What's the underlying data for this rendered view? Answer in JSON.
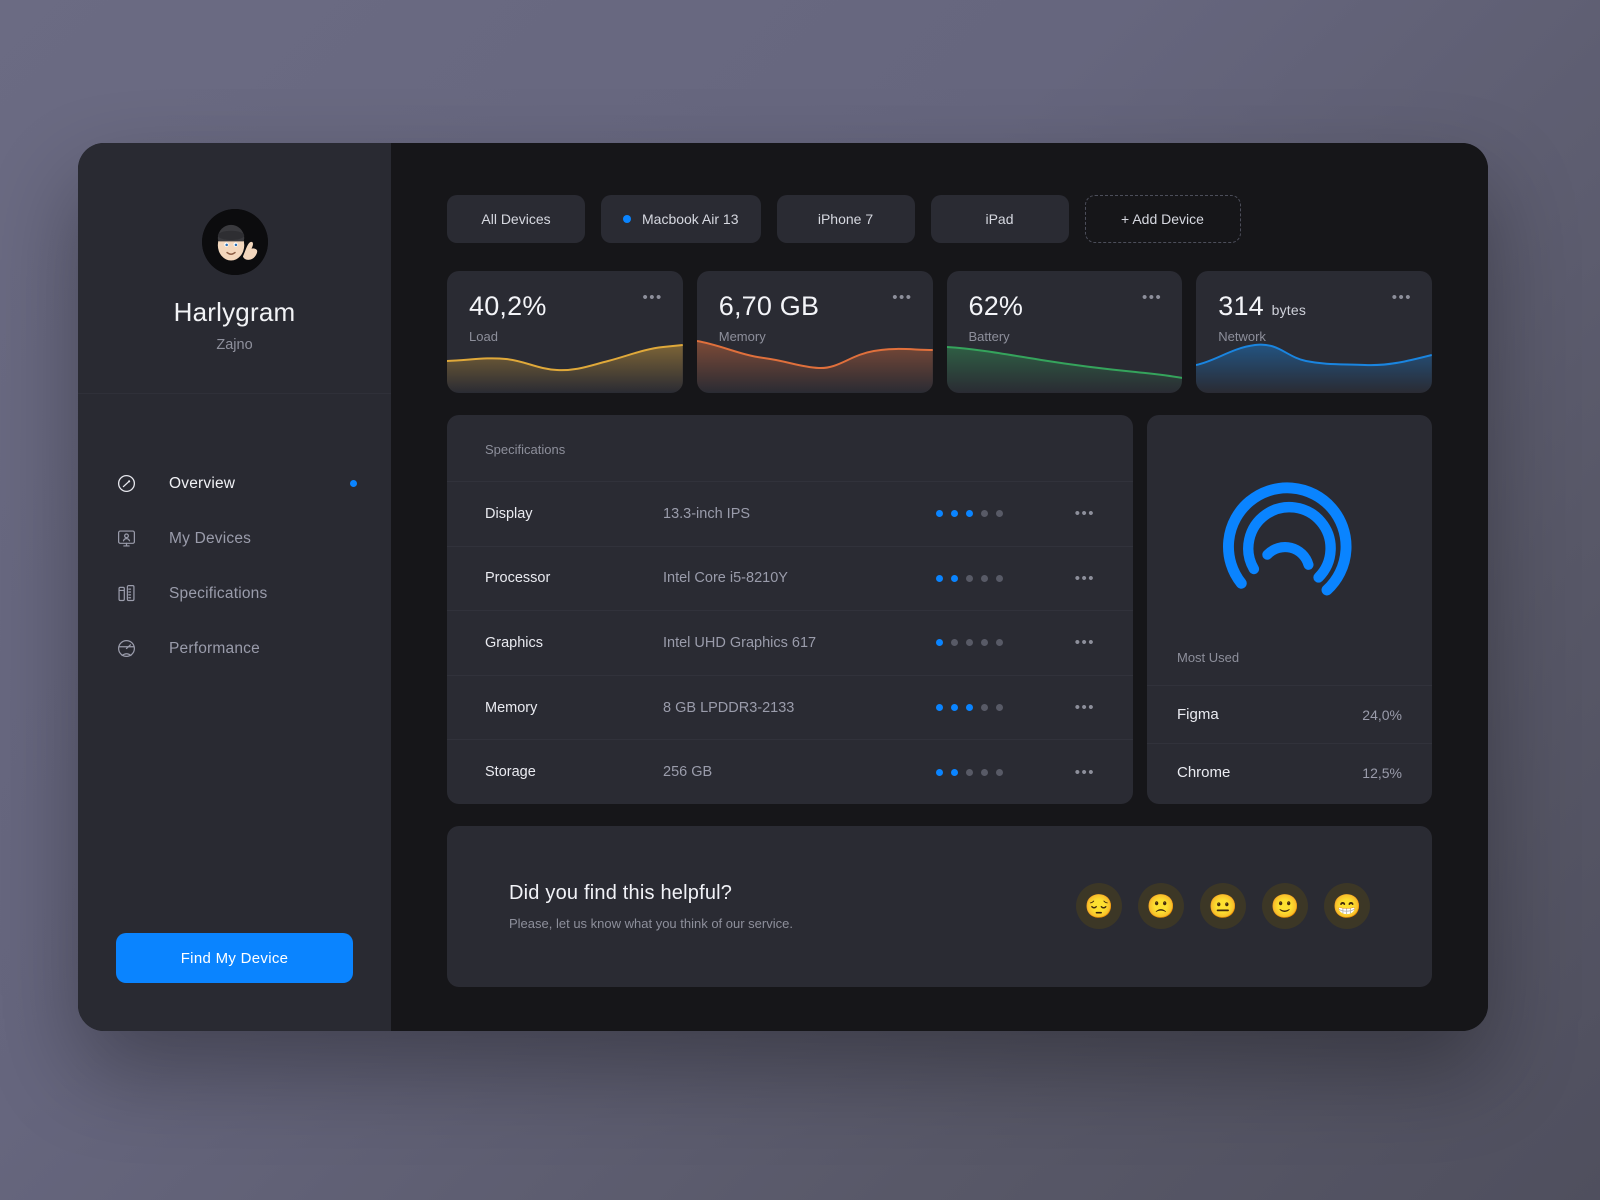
{
  "sidebar": {
    "avatar_icon": "memoji-thumbs-up-avatar",
    "avatar_glyph": "🧑‍🦲",
    "name": "Harlygram",
    "org": "Zajno",
    "nav": [
      {
        "label": "Overview",
        "icon": "speedometer-icon",
        "active": true,
        "badge": true
      },
      {
        "label": "My Devices",
        "icon": "monitor-user-icon",
        "active": false,
        "badge": false
      },
      {
        "label": "Specifications",
        "icon": "spec-bars-icon",
        "active": false,
        "badge": false
      },
      {
        "label": "Performance",
        "icon": "performance-icon",
        "active": false,
        "badge": false
      }
    ],
    "find_button": "Find My Device"
  },
  "tabs": [
    {
      "label": "All Devices",
      "active": false,
      "add": false
    },
    {
      "label": "Macbook Air 13",
      "active": true,
      "add": false
    },
    {
      "label": "iPhone 7",
      "active": false,
      "add": false
    },
    {
      "label": "iPad",
      "active": false,
      "add": false
    },
    {
      "label": "+ Add Device",
      "active": false,
      "add": true
    }
  ],
  "stats": [
    {
      "value": "40,2%",
      "unit": "",
      "label": "Load",
      "color": "#e0a93a",
      "menu": "•••"
    },
    {
      "value": "6,70 GB",
      "unit": "",
      "label": "Memory",
      "color": "#e0703c",
      "menu": "•••"
    },
    {
      "value": "62%",
      "unit": "",
      "label": "Battery",
      "color": "#35a45c",
      "menu": "•••"
    },
    {
      "value": "314",
      "unit": "bytes",
      "label": "Network",
      "color": "#1a85e0",
      "menu": "•••"
    }
  ],
  "specifications": {
    "title": "Specifications",
    "rows": [
      {
        "name": "Display",
        "value": "13.3-inch IPS",
        "rating": 3,
        "max": 5,
        "menu": "•••"
      },
      {
        "name": "Processor",
        "value": "Intel Core i5-8210Y",
        "rating": 2,
        "max": 5,
        "menu": "•••"
      },
      {
        "name": "Graphics",
        "value": "Intel UHD Graphics 617",
        "rating": 1,
        "max": 5,
        "menu": "•••"
      },
      {
        "name": "Memory",
        "value": "8 GB LPDDR3-2133",
        "rating": 3,
        "max": 5,
        "menu": "•••"
      },
      {
        "name": "Storage",
        "value": "256 GB",
        "rating": 2,
        "max": 5,
        "menu": "•••"
      }
    ]
  },
  "most_used": {
    "gauge_icon": "radial-arcs-gauge-icon",
    "title": "Most Used",
    "rows": [
      {
        "name": "Figma",
        "percent": "24,0%"
      },
      {
        "name": "Chrome",
        "percent": "12,5%"
      }
    ]
  },
  "feedback": {
    "title": "Did you find this helpful?",
    "subtitle": "Please, let us know what you think of our service.",
    "ratings": [
      {
        "glyph": "😔",
        "icon": "pensive-face-icon"
      },
      {
        "glyph": "🙁",
        "icon": "slightly-frowning-face-icon"
      },
      {
        "glyph": "😐",
        "icon": "neutral-face-icon"
      },
      {
        "glyph": "🙂",
        "icon": "slightly-smiling-face-icon"
      },
      {
        "glyph": "😁",
        "icon": "beaming-face-icon"
      }
    ]
  },
  "colors": {
    "accent": "#0a84ff",
    "card": "#2a2b33",
    "sidebar": "#292a32",
    "content": "#161619"
  },
  "chart_data": [
    {
      "type": "area",
      "title": "Load",
      "values": [
        40.0,
        39.6,
        39.2,
        39.8,
        41.2,
        41.6,
        40.9,
        40.0,
        39.7,
        40.1,
        41.0,
        42.3,
        43.2,
        43.8
      ],
      "ylabel": "%",
      "xlabel": "",
      "grid": false,
      "series_color": "#e0a93a"
    },
    {
      "type": "area",
      "title": "Memory",
      "values": [
        6.95,
        6.85,
        6.72,
        6.6,
        6.52,
        6.46,
        6.4,
        6.42,
        6.55,
        6.78,
        6.92,
        6.95,
        6.94,
        6.93
      ],
      "ylabel": "GB",
      "xlabel": "",
      "grid": false,
      "series_color": "#e0703c"
    },
    {
      "type": "area",
      "title": "Battery",
      "values": [
        68,
        67,
        66.5,
        66,
        65.6,
        65,
        64.4,
        63.8,
        63.2,
        62.8,
        62.4,
        62.0,
        61.5,
        61.0
      ],
      "ylabel": "%",
      "xlabel": "",
      "grid": false,
      "series_color": "#35a45c"
    },
    {
      "type": "area",
      "title": "Network",
      "values": [
        280,
        305,
        340,
        372,
        384,
        370,
        335,
        312,
        306,
        308,
        304,
        300,
        312,
        330
      ],
      "ylabel": "bytes",
      "xlabel": "",
      "grid": false,
      "series_color": "#1a85e0"
    }
  ]
}
